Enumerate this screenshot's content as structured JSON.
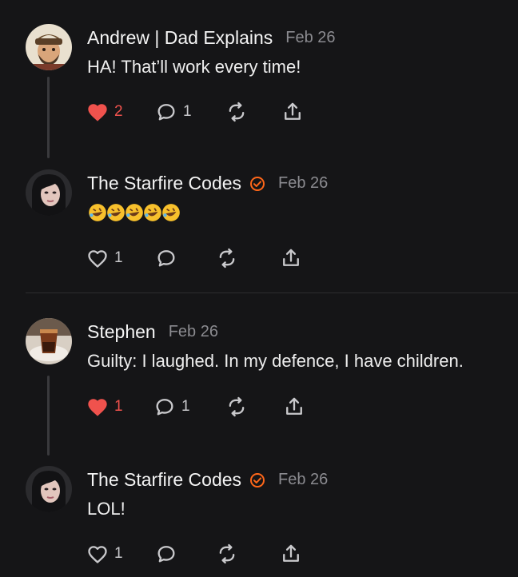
{
  "comments": [
    {
      "author": "Andrew | Dad Explains",
      "verified": false,
      "date": "Feb 26",
      "text": "HA! That’ll work every time!",
      "liked": true,
      "likes": "2",
      "replies": "1"
    },
    {
      "author": "The Starfire Codes",
      "verified": true,
      "date": "Feb 26",
      "text": "🤣🤣🤣🤣🤣",
      "liked": false,
      "likes": "1",
      "replies": ""
    },
    {
      "author": "Stephen",
      "verified": false,
      "date": "Feb 26",
      "text": "Guilty: I laughed. In my defence, I have children.",
      "liked": true,
      "likes": "1",
      "replies": "1"
    },
    {
      "author": "The Starfire Codes",
      "verified": true,
      "date": "Feb 26",
      "text": "LOL!",
      "liked": false,
      "likes": "1",
      "replies": ""
    }
  ],
  "icons": {
    "like": "heart-icon",
    "reply": "comment-bubble-icon",
    "restack": "restack-icon",
    "share": "share-icon",
    "verified": "verified-check-icon"
  },
  "colors": {
    "background": "#151517",
    "like_active": "#f0524d",
    "verified": "#ff6719",
    "muted": "#8b8b90"
  }
}
